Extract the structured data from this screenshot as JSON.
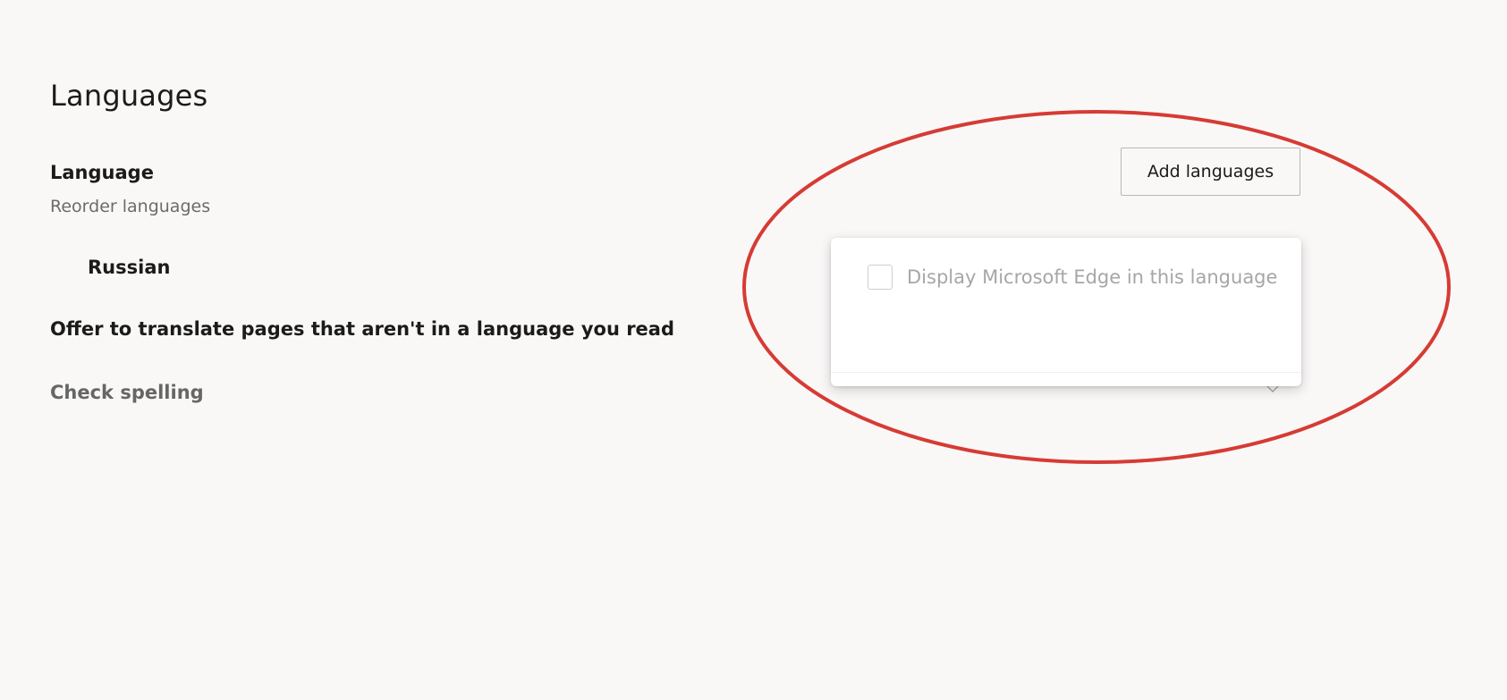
{
  "page": {
    "title": "Languages"
  },
  "language_section": {
    "title": "Language",
    "subtitle": "Reorder languages",
    "items": [
      {
        "label": "Russian"
      }
    ],
    "add_button_label": "Add languages"
  },
  "flyout": {
    "checkbox_label": "Display Microsoft Edge in this language",
    "checked": false
  },
  "offer_translate": {
    "label": "Offer to translate pages that aren't in a language you read"
  },
  "check_spelling": {
    "label": "Check spelling"
  },
  "icons": {
    "behind_chevron": "chevron-down-icon"
  },
  "colors": {
    "background": "#f9f8f7",
    "annotation": "#d63b34",
    "muted_text": "#6b6b6b",
    "disabled_text": "#a6a6a6"
  }
}
